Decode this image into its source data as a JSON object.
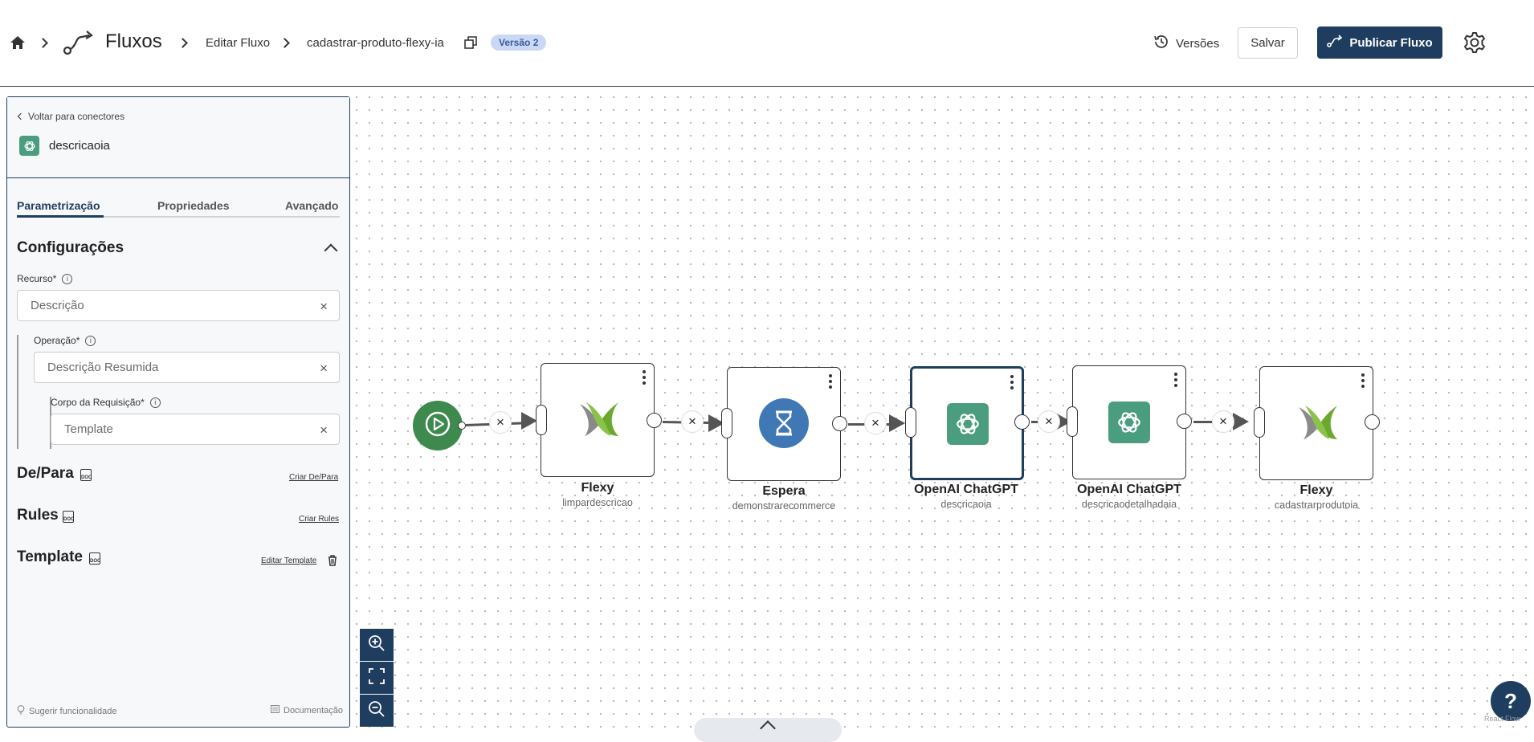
{
  "header": {
    "app_title": "Fluxos",
    "breadcrumb_edit": "Editar Fluxo",
    "flow_name": "cadastrar-produto-flexy-ia",
    "version_badge": "Versão 2",
    "versions_label": "Versões",
    "save_label": "Salvar",
    "publish_label": "Publicar Fluxo"
  },
  "panel": {
    "back_label": "Voltar para conectores",
    "node_name": "descricaoia",
    "tabs": [
      "Parametrização",
      "Propriedades",
      "Avançado"
    ],
    "config_title": "Configurações",
    "recurso_label": "Recurso*",
    "recurso_value": "Descrição",
    "operacao_label": "Operação*",
    "operacao_value": "Descrição Resumida",
    "corpo_label": "Corpo da Requisição*",
    "corpo_value": "Template",
    "depara_title": "De/Para",
    "depara_link": "Criar De/Para",
    "rules_title": "Rules",
    "rules_link": "Criar Rules",
    "template_title": "Template",
    "template_link": "Editar Template",
    "doc_icon_text": "DOC",
    "suggest_label": "Sugerir funcionalidade",
    "docs_label": "Documentação"
  },
  "nodes": [
    {
      "title": "Flexy",
      "subtitle": "limpardescricao",
      "icon": "flexy-logo-icon"
    },
    {
      "title": "Espera",
      "subtitle": "demonstrarecommerce",
      "icon": "hourglass-icon"
    },
    {
      "title": "OpenAI ChatGPT",
      "subtitle": "descricaoia",
      "icon": "openai-icon",
      "selected": true
    },
    {
      "title": "OpenAI ChatGPT",
      "subtitle": "descricaodetalhadaia",
      "icon": "openai-icon"
    },
    {
      "title": "Flexy",
      "subtitle": "cadastrarprodutoia",
      "icon": "flexy-logo-icon"
    }
  ],
  "edge_delete_glyph": "×",
  "help_glyph": "?",
  "attribution": "React Flow",
  "colors": {
    "primary": "#1f3d5e",
    "start_node": "#3e8a4e",
    "openai": "#4a9d7e",
    "wait": "#3f78b5",
    "badge_bg": "#c9d9f5"
  }
}
